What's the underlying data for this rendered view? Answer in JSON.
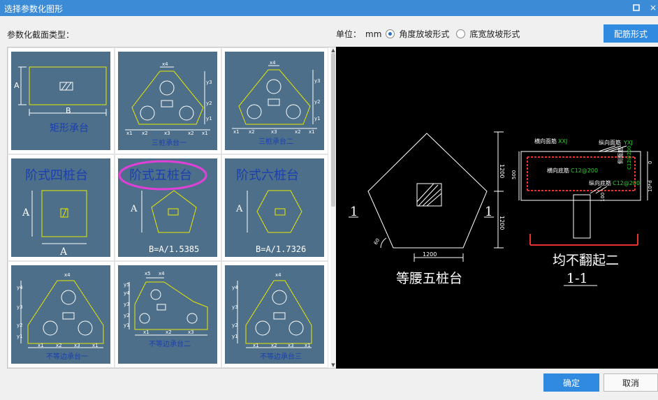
{
  "window": {
    "title": "选择参数化图形",
    "maximize_icon": "square",
    "close_icon": "×"
  },
  "section_label": "参数化截面类型：",
  "unit": {
    "label": "单位：",
    "value": "mm"
  },
  "slope_options": [
    {
      "label": "角度放坡形式",
      "selected": true
    },
    {
      "label": "底宽放坡形式",
      "selected": false
    }
  ],
  "rebar_button": "配筋形式",
  "gallery": {
    "items": [
      {
        "caption": "矩形承台",
        "dims": [
          "A",
          "B"
        ]
      },
      {
        "caption": "三桩承台一",
        "dims": [
          "x4",
          "y3",
          "y2",
          "y1",
          "x1",
          "x2",
          "x3",
          "x2",
          "x1"
        ]
      },
      {
        "caption": "三桩承台二",
        "dims": [
          "x4",
          "y3",
          "y2",
          "y1",
          "x1",
          "x2",
          "x3",
          "x2",
          "x1"
        ]
      },
      {
        "caption": "阶式四桩台",
        "dims": [
          "A",
          "A"
        ]
      },
      {
        "caption": "阶式五桩台",
        "dims": [
          "A",
          "B=A/1.5385"
        ],
        "highlighted": true
      },
      {
        "caption": "阶式六桩台",
        "dims": [
          "A",
          "B=A/1.7326"
        ]
      },
      {
        "caption": "不等边承台一",
        "dims": [
          "x4",
          "y4",
          "y3",
          "y2",
          "y1",
          "x1",
          "x2",
          "x3",
          "x1"
        ]
      },
      {
        "caption": "不等边承台二",
        "dims": [
          "x5",
          "x4",
          "y5",
          "y4",
          "y3",
          "y2",
          "y1",
          "x1",
          "x2",
          "x3"
        ]
      },
      {
        "caption": "不等边承台三",
        "dims": [
          "x4",
          "y4",
          "y3",
          "y2",
          "y1",
          "x1",
          "x2",
          "x3",
          "x1"
        ]
      }
    ]
  },
  "preview": {
    "left_title": "等腰五桩台",
    "left_label_1": "1",
    "left_label_1b": "1",
    "dim_1200_a": "1200",
    "dim_1200_b": "1200",
    "dim_1200_c": "1200",
    "angle": "60",
    "right_title": "均不翻起二",
    "section_label": "1-1",
    "height_dim": "500",
    "top_rebar_h": "横向面筋",
    "top_rebar_h_val": "XXJ",
    "top_rebar_v": "纵向面筋",
    "top_rebar_v_val": "YXJ",
    "bottom_rebar_h": "横向底筋",
    "bottom_rebar_h_val": "C12@200",
    "bottom_rebar_v": "纵向底筋",
    "bottom_rebar_v_val": "C12@200",
    "side_rebar": "侧面筋",
    "side_rebar_val": "C12@200",
    "dim_right_top": "0",
    "dim_right_bot": "10*d",
    "dim_pile": "100"
  },
  "buttons": {
    "ok": "确定",
    "cancel": "取消"
  }
}
